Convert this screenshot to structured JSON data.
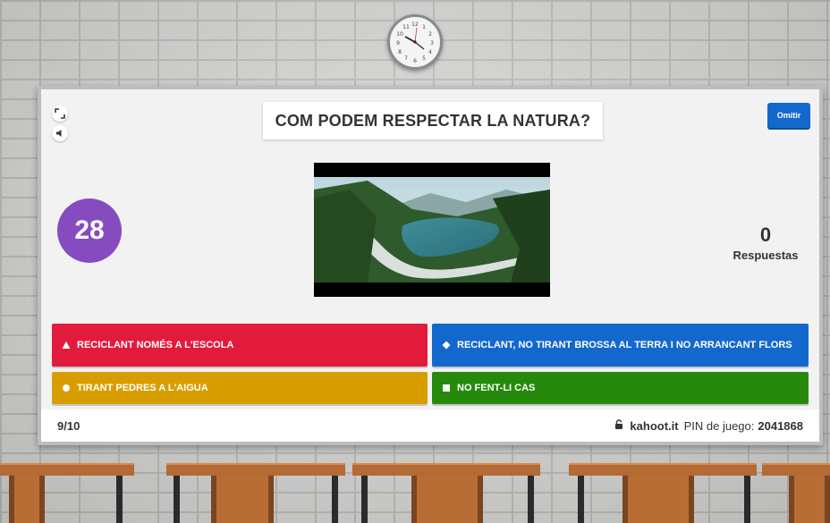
{
  "question": "COM PODEM RESPECTAR LA NATURA?",
  "skip_button": "Omitir",
  "timer": "28",
  "answers": {
    "count": "0",
    "label": "Respuestas"
  },
  "options": [
    {
      "label": "RECICLANT NOMÉS A L'ESCOLA",
      "shape": "triangle-icon",
      "color": "#e21b3c"
    },
    {
      "label": "RECICLANT, NO TIRANT BROSSA AL TERRA I NO ARRANCANT FLORS",
      "shape": "diamond-icon",
      "color": "#1368ce"
    },
    {
      "label": "TIRANT PEDRES A L'AIGUA",
      "shape": "circle-icon",
      "color": "#d89e00"
    },
    {
      "label": "NO FENT-LI CAS",
      "shape": "square-icon",
      "color": "#26890c"
    }
  ],
  "footer": {
    "question_count": "9/10",
    "brand": "kahoot.it",
    "pin_label": "PIN de juego:",
    "pin": "2041868"
  },
  "colors": {
    "timer": "#864cbf",
    "skip": "#1368ce"
  },
  "icons": [
    "fullscreen-icon",
    "volume-icon",
    "lock-icon",
    "clock-icon"
  ]
}
